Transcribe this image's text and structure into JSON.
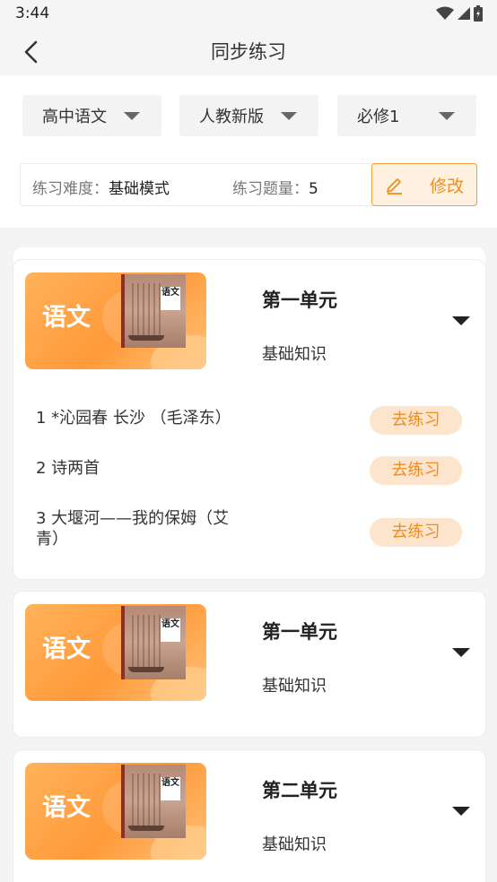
{
  "status": {
    "time": "3:44"
  },
  "header": {
    "title": "同步练习"
  },
  "filters": {
    "subject": "高中语文",
    "edition": "人教新版",
    "volume": "必修1"
  },
  "settings": {
    "difficulty_label": "练习难度：",
    "difficulty_value": "基础模式",
    "count_label": "练习题量：",
    "count_value": "5",
    "edit_label": "修改"
  },
  "cards": [
    {
      "subject": "语文",
      "book_label": "语文",
      "unit": "第一单元",
      "subtitle": "基础知识",
      "expanded": true,
      "lessons": [
        {
          "title": "1 *沁园春 长沙 （毛泽东）",
          "action": "去练习"
        },
        {
          "title": "2 诗两首",
          "action": "去练习"
        },
        {
          "title": "3 大堰河——我的保姆（艾青）",
          "action": "去练习"
        }
      ]
    },
    {
      "subject": "语文",
      "book_label": "语文",
      "unit": "第一单元",
      "subtitle": "基础知识",
      "expanded": false,
      "lessons": []
    },
    {
      "subject": "语文",
      "book_label": "语文",
      "unit": "第二单元",
      "subtitle": "基础知识",
      "expanded": false,
      "lessons": []
    }
  ],
  "colors": {
    "accent": "#f08d1d",
    "accent_bg": "#fde4cc",
    "cover": "#ff9a3a"
  },
  "icons": [
    "wifi-icon",
    "signal-icon",
    "battery-icon",
    "back-arrow-icon",
    "pencil-icon",
    "dropdown-arrow-icon"
  ]
}
